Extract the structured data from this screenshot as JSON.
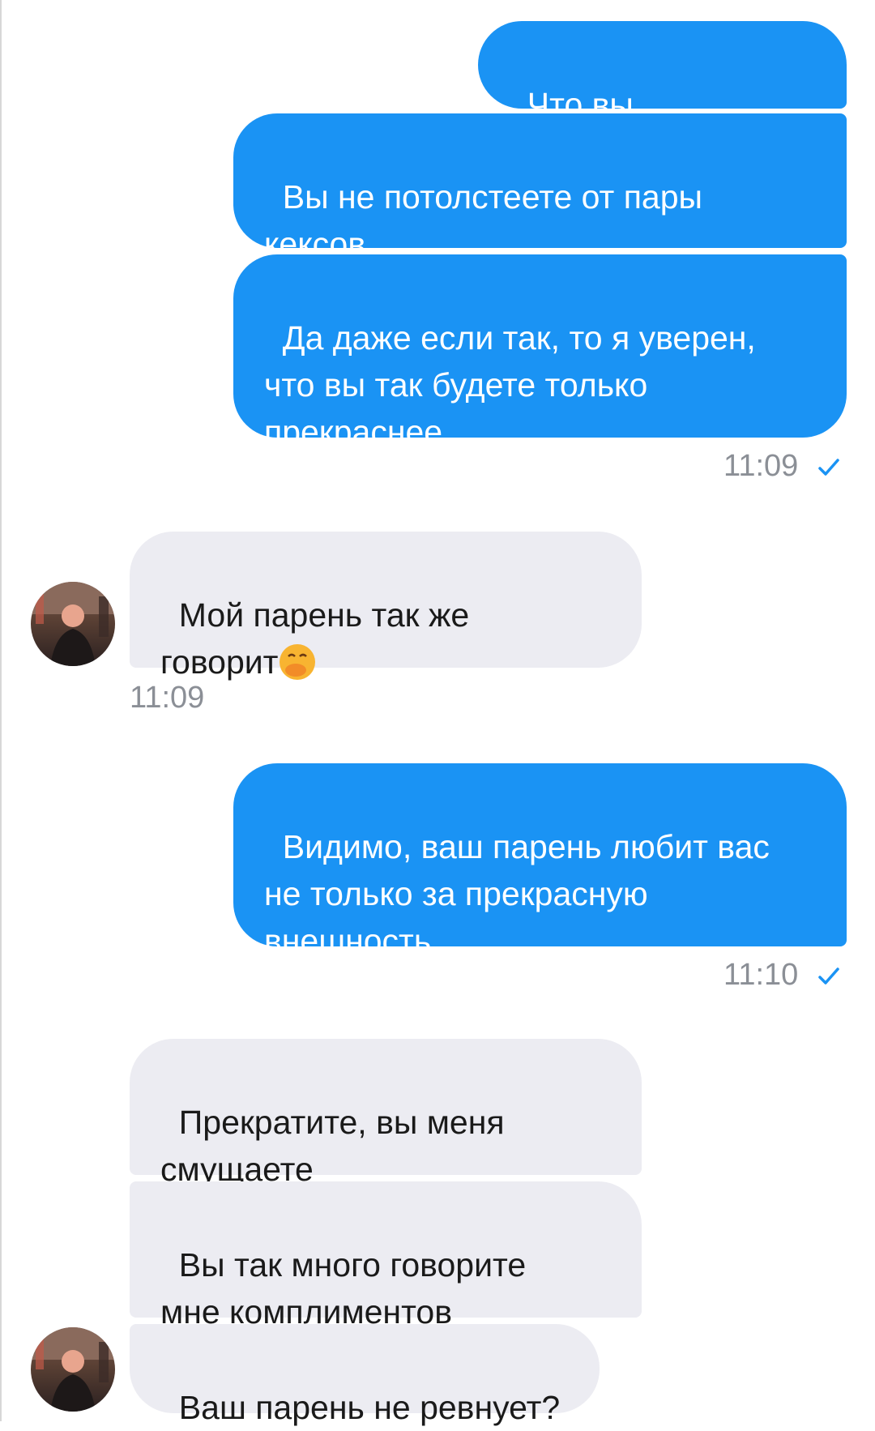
{
  "messages": [
    {
      "text": "Что вы"
    },
    {
      "text": "Вы не потолстеете от пары\nкексов"
    },
    {
      "text": "Да даже если так, то я уверен,\nчто вы так будете только\nпрекраснее"
    },
    {
      "text": "Мой парень так же\nговорит"
    },
    {
      "text": "Видимо, ваш парень любит вас\nне только за прекрасную\nвнешность"
    },
    {
      "text": "Прекратите, вы меня\nсмущаете"
    },
    {
      "text": "Вы так много говорите\nмне комплиментов"
    },
    {
      "text": "Ваш парень не ревнует?"
    }
  ],
  "timestamps": {
    "t1": "11:09",
    "t2": "11:09",
    "t3": "11:10"
  },
  "icons": {
    "read_check": "check-icon",
    "emoji": "face-with-hand-over-mouth-emoji",
    "avatar": "contact-avatar"
  },
  "colors": {
    "outgoing": "#1a93f4",
    "incoming": "#ececf2",
    "check": "#1a93f4",
    "time": "#8b8f96"
  }
}
